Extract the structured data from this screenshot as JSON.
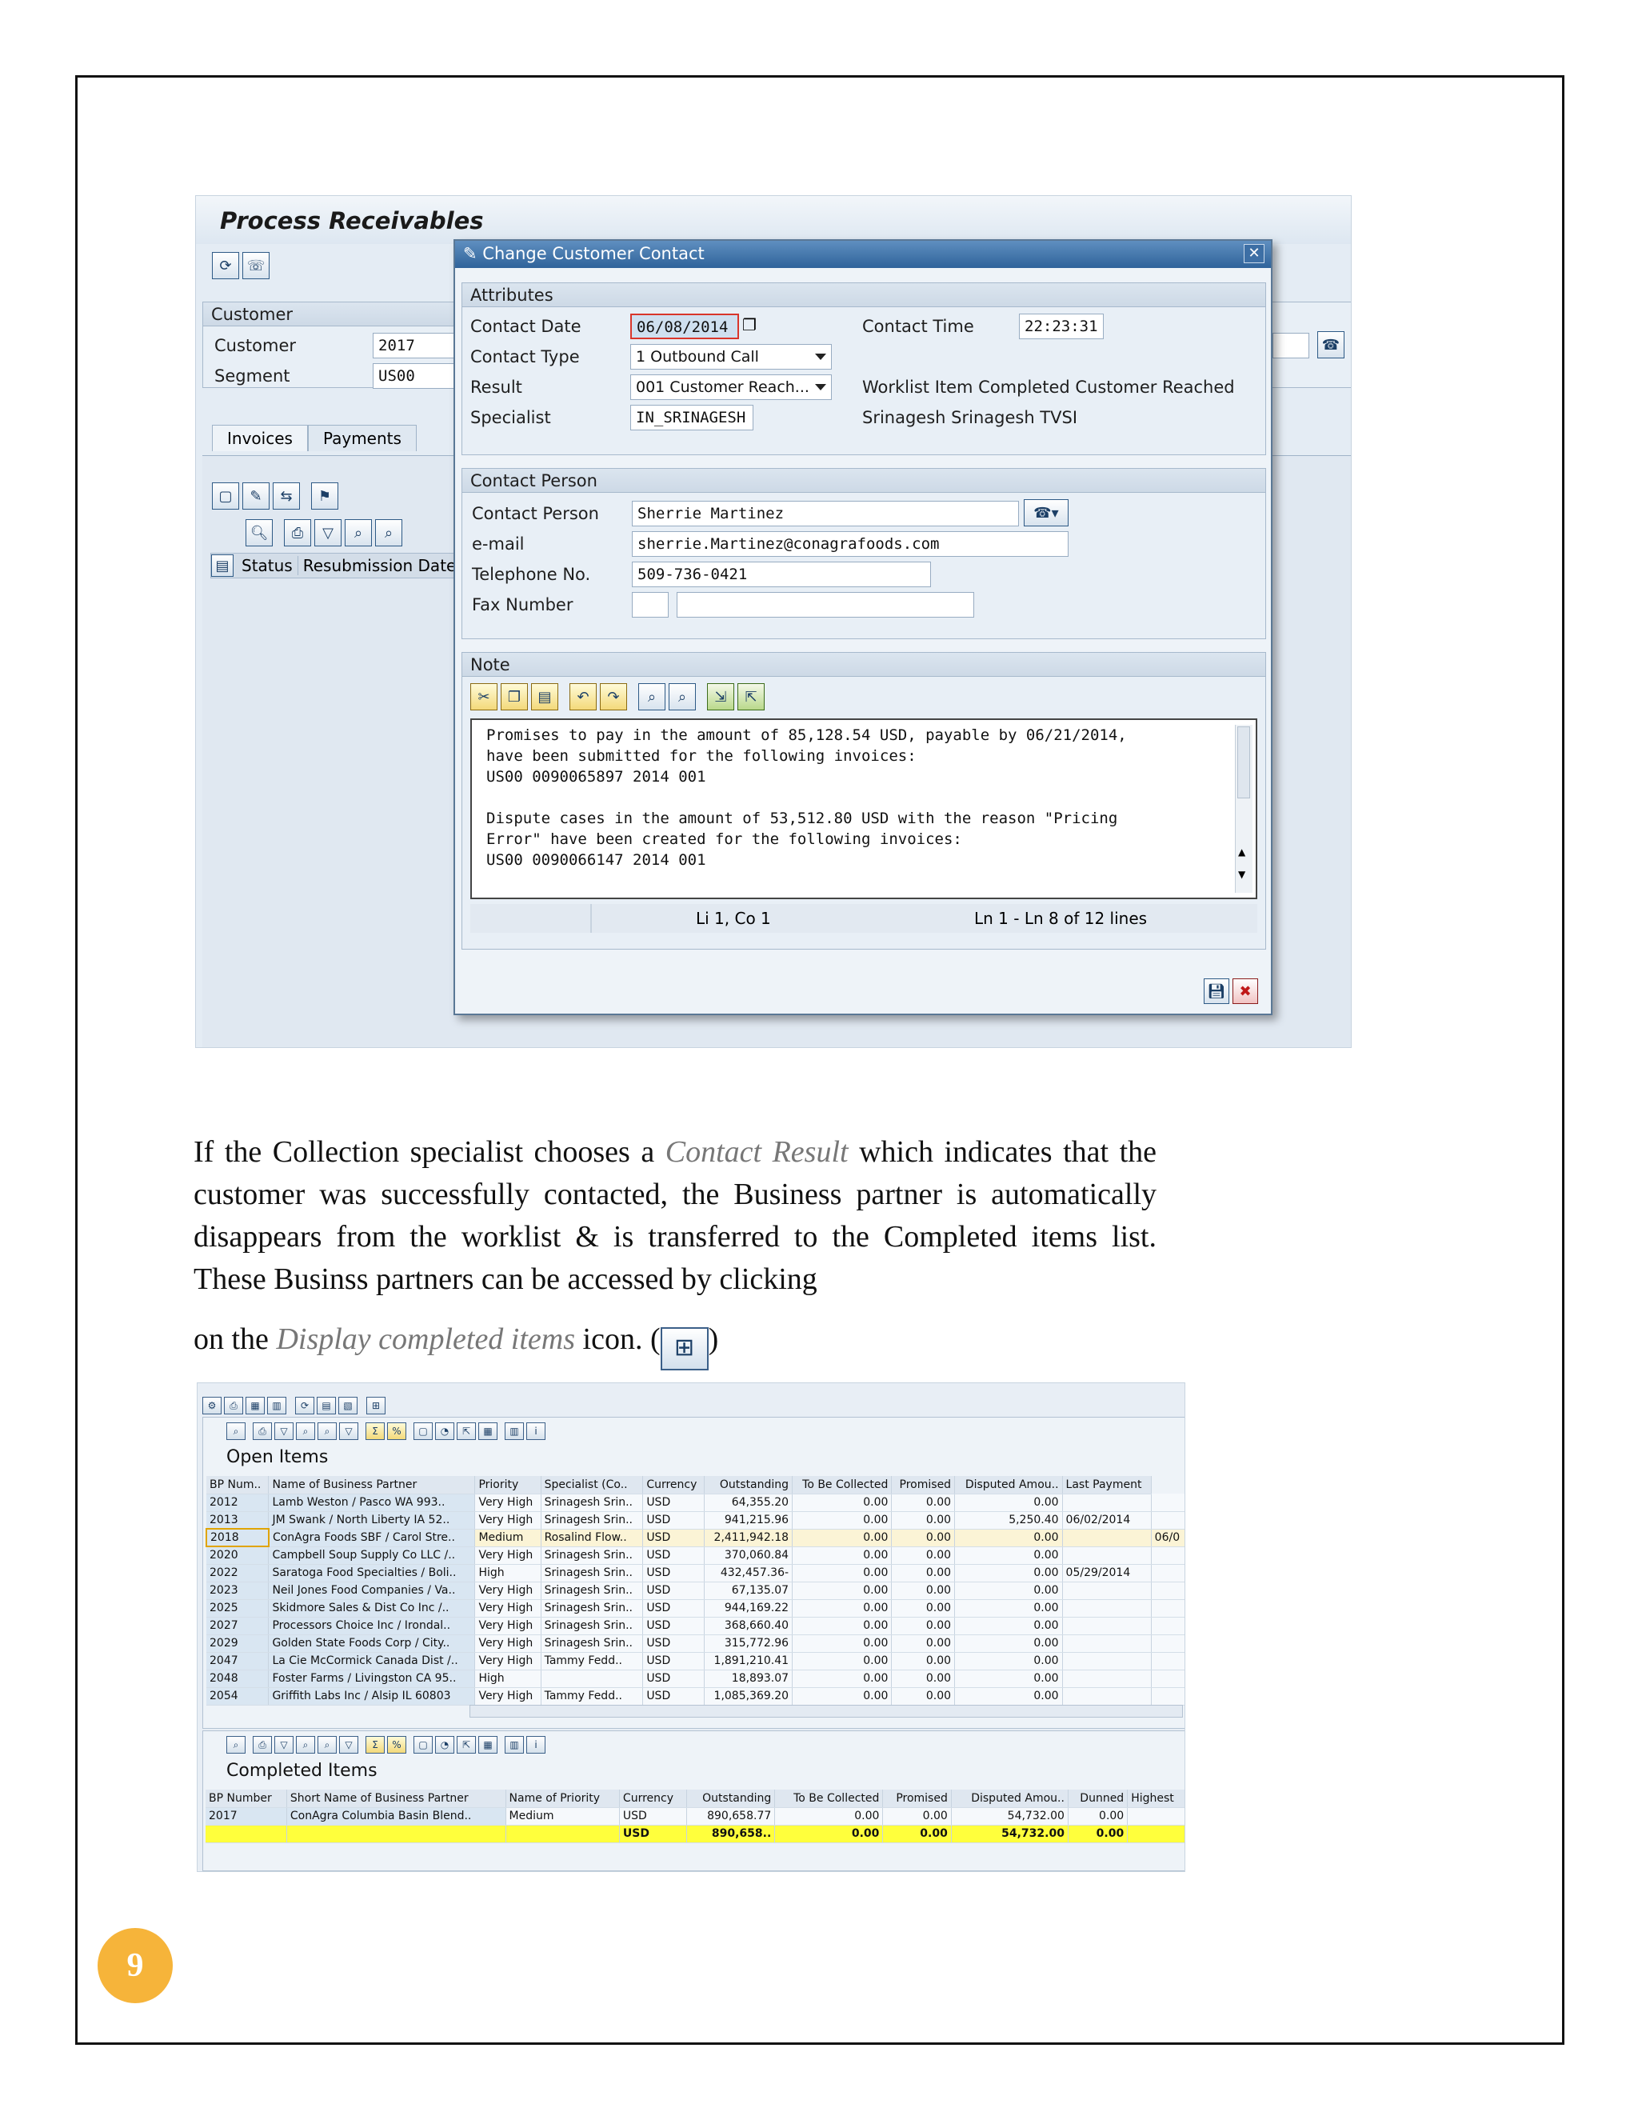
{
  "page_number": "9",
  "screenshot1": {
    "title": "Process Receivables",
    "customer_group_title": "Customer",
    "customer_label": "Customer",
    "customer_value": "2017",
    "segment_label": "Segment",
    "segment_value": "US00",
    "tabs": [
      "Invoices",
      "Payments"
    ],
    "list_headers": [
      "Status",
      "Resubmission Date"
    ],
    "dialog": {
      "title": "Change Customer Contact",
      "attributes_title": "Attributes",
      "contact_date_label": "Contact Date",
      "contact_date_value": "06/08/2014",
      "contact_time_label": "Contact Time",
      "contact_time_value": "22:23:31",
      "contact_type_label": "Contact Type",
      "contact_type_value": "1 Outbound Call",
      "result_label": "Result",
      "result_value": "001 Customer Reach...",
      "result_text": "Worklist Item Completed Customer Reached",
      "specialist_label": "Specialist",
      "specialist_value": "IN_SRINAGESH",
      "specialist_text": "Srinagesh Srinagesh TVSI",
      "contact_person_title": "Contact Person",
      "contact_person_label": "Contact Person",
      "contact_person_value": "Sherrie Martinez",
      "email_label": "e-mail",
      "email_value": "sherrie.Martinez@conagrafoods.com",
      "telephone_label": "Telephone No.",
      "telephone_value": "509-736-0421",
      "fax_label": "Fax Number",
      "note_title": "Note",
      "note_text": "Promises to pay in the amount of 85,128.54 USD, payable by 06/21/2014,\nhave been submitted for the following invoices:\nUS00 0090065897 2014 001\n\nDispute cases in the amount of 53,512.80 USD with the reason \"Pricing\nError\" have been created for the following invoices:\nUS00 0090066147 2014 001",
      "cursor_pos": "Li 1, Co 1",
      "line_info": "Ln 1 - Ln 8 of 12 lines"
    }
  },
  "paragraph": {
    "part1": "If the Collection specialist chooses a ",
    "italic1": "Contact Result",
    "part2": " which indicates that the customer was successfully contacted, the Business partner is automatically disappears from the worklist & is transferred to the Completed items list. These Businss partners can be accessed by clicking",
    "part3": "on the ",
    "italic2": "Display completed items",
    "part4": " icon. (",
    "part5": ")"
  },
  "screenshot2": {
    "open_title": "Open Items",
    "open_headers": [
      "BP Num..",
      "Name of Business Partner",
      "Priority",
      "Specialist (Co..",
      "Currency",
      "Outstanding",
      "To Be Collected",
      "Promised",
      "Disputed Amou..",
      "Last Payment"
    ],
    "open_rows": [
      [
        "2012",
        "Lamb Weston / Pasco WA 993..",
        "Very High",
        "Srinagesh Srin..",
        "USD",
        "64,355.20",
        "0.00",
        "0.00",
        "0.00",
        ""
      ],
      [
        "2013",
        "JM Swank / North Liberty IA 52..",
        "Very High",
        "Srinagesh Srin..",
        "USD",
        "941,215.96",
        "0.00",
        "0.00",
        "5,250.40",
        "06/02/2014"
      ],
      [
        "2018",
        "ConAgra Foods SBF / Carol Stre..",
        "Medium",
        "Rosalind Flow..",
        "USD",
        "2,411,942.18",
        "0.00",
        "0.00",
        "0.00",
        ""
      ],
      [
        "2020",
        "Campbell Soup Supply Co LLC /..",
        "Very High",
        "Srinagesh Srin..",
        "USD",
        "370,060.84",
        "0.00",
        "0.00",
        "0.00",
        ""
      ],
      [
        "2022",
        "Saratoga Food Specialties / Boli..",
        "High",
        "Srinagesh Srin..",
        "USD",
        "432,457.36-",
        "0.00",
        "0.00",
        "0.00",
        "05/29/2014"
      ],
      [
        "2023",
        "Neil Jones Food Companies / Va..",
        "Very High",
        "Srinagesh Srin..",
        "USD",
        "67,135.07",
        "0.00",
        "0.00",
        "0.00",
        ""
      ],
      [
        "2025",
        "Skidmore Sales & Dist Co Inc /..",
        "Very High",
        "Srinagesh Srin..",
        "USD",
        "944,169.22",
        "0.00",
        "0.00",
        "0.00",
        ""
      ],
      [
        "2027",
        "Processors Choice Inc / Irondal..",
        "Very High",
        "Srinagesh Srin..",
        "USD",
        "368,660.40",
        "0.00",
        "0.00",
        "0.00",
        ""
      ],
      [
        "2029",
        "Golden State Foods Corp / City..",
        "Very High",
        "Srinagesh Srin..",
        "USD",
        "315,772.96",
        "0.00",
        "0.00",
        "0.00",
        ""
      ],
      [
        "2047",
        "La Cie McCormick Canada Dist /..",
        "Very High",
        "Tammy Fedd..",
        "USD",
        "1,891,210.41",
        "0.00",
        "0.00",
        "0.00",
        ""
      ],
      [
        "2048",
        "Foster Farms / Livingston CA 95..",
        "High",
        "",
        "USD",
        "18,893.07",
        "0.00",
        "0.00",
        "0.00",
        ""
      ],
      [
        "2054",
        "Griffith Labs Inc / Alsip IL 60803",
        "Very High",
        "Tammy Fedd..",
        "USD",
        "1,085,369.20",
        "0.00",
        "0.00",
        "0.00",
        ""
      ]
    ],
    "open_extra_value": "06/0",
    "completed_title": "Completed Items",
    "completed_headers": [
      "BP Number",
      "Short Name of Business Partner",
      "Name of Priority",
      "Currency",
      "Outstanding",
      "To Be Collected",
      "Promised",
      "Disputed Amou..",
      "Dunned",
      "Highest"
    ],
    "completed_rows": [
      [
        "2017",
        "ConAgra Columbia Basin Blend..",
        "Medium",
        "USD",
        "890,658.77",
        "0.00",
        "0.00",
        "54,732.00",
        "0.00",
        ""
      ]
    ],
    "completed_total": [
      "",
      "",
      "",
      "USD",
      "890,658..",
      "0.00",
      "0.00",
      "54,732.00",
      "0.00",
      ""
    ]
  }
}
